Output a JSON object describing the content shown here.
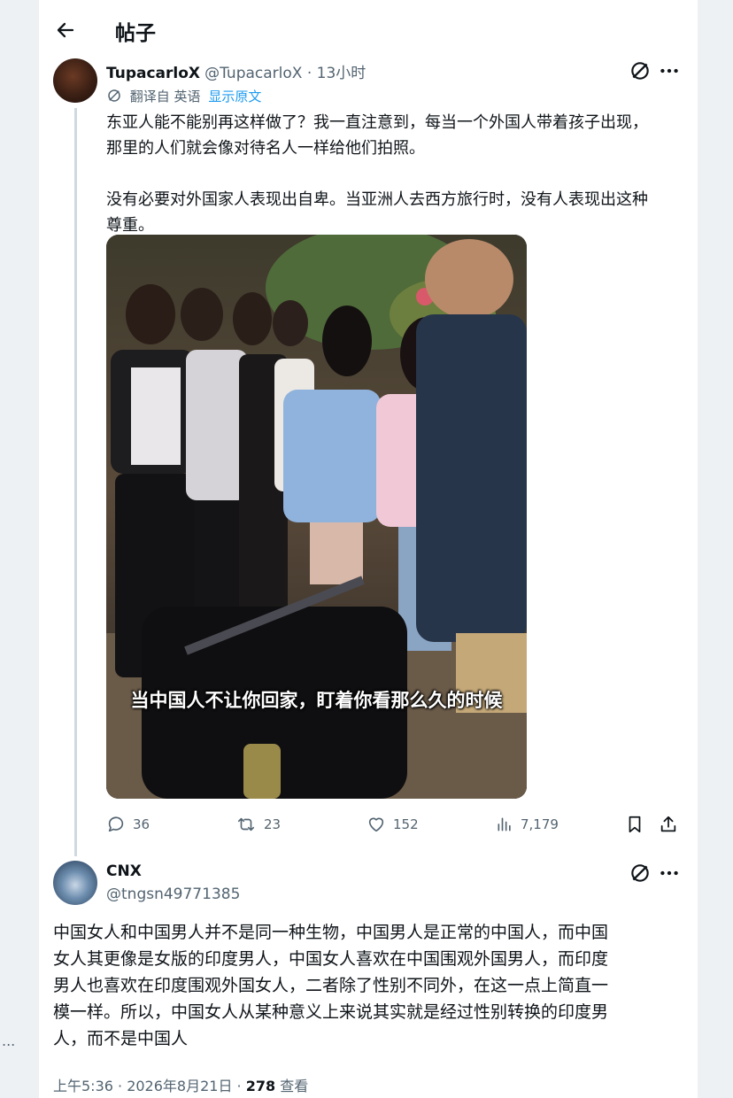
{
  "header": {
    "title": "帖子"
  },
  "post": {
    "name": "TupacarloX",
    "handle": "@TupacarloX",
    "time_sep": " · ",
    "time": "13小时",
    "translated_from": "翻译自 英语",
    "show_original": "显示原文",
    "text": "东亚人能不能别再这样做了？我一直注意到，每当一个外国人带着孩子出现，\n那里的人们就会像对待名人一样给他们拍照。\n\n没有必要对外国家人表现出自卑。当亚洲人去西方旅行时，没有人表现出这种\n尊重。",
    "media_caption": "当中国人不让你回家，盯着你看那么久的时候",
    "stats": {
      "replies": "36",
      "reposts": "23",
      "likes": "152",
      "views": "7,179"
    }
  },
  "reply": {
    "name": "CNX",
    "handle": "@tngsn49771385",
    "text": "中国女人和中国男人并不是同一种生物，中国男人是正常的中国人，而中国\n女人其更像是女版的印度男人，中国女人喜欢在中国围观外国男人，而印度\n男人也喜欢在印度围观外国女人，二者除了性别不同外，在这一点上简直一\n模一样。所以，中国女人从某种意义上来说其实就是经过性别转换的印度男\n人，而不是中国人",
    "timestamp": "上午5:36 · 2026年8月21日 · ",
    "views_count": "278",
    "views_label": " 查看"
  },
  "side": {
    "dots": "..."
  },
  "icons": {
    "back": "back-arrow-icon",
    "grok": "grok-icon",
    "more": "more-icon",
    "translate": "translate-icon",
    "reply": "reply-icon",
    "repost": "repost-icon",
    "like": "like-icon",
    "views": "views-icon",
    "bookmark": "bookmark-icon",
    "share": "share-icon"
  },
  "colors": {
    "link": "#1d9bf0",
    "muted": "#536471",
    "text": "#0f1419"
  }
}
